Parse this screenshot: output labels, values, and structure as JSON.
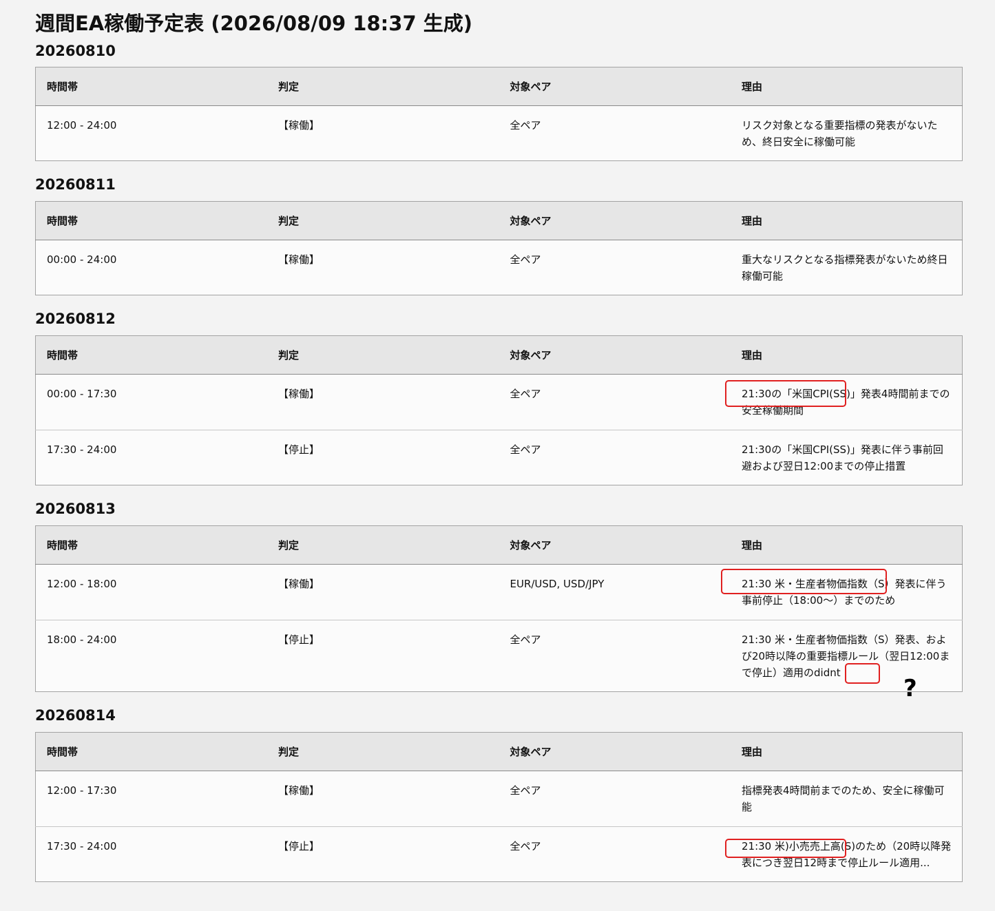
{
  "page_title": "週間EA稼働予定表 (2026/08/09 18:37 生成)",
  "headers": {
    "time": "時間帯",
    "verdict": "判定",
    "pair": "対象ペア",
    "reason": "理由"
  },
  "days": [
    {
      "date": "20260810",
      "rows": [
        {
          "time": "12:00 - 24:00",
          "verdict": "【稼働】",
          "pair": "全ペア",
          "reason": "リスク対象となる重要指標の発表がないため、終日安全に稼働可能"
        }
      ]
    },
    {
      "date": "20260811",
      "rows": [
        {
          "time": "00:00 - 24:00",
          "verdict": "【稼働】",
          "pair": "全ペア",
          "reason": "重大なリスクとなる指標発表がないため終日稼働可能"
        }
      ]
    },
    {
      "date": "20260812",
      "rows": [
        {
          "time": "00:00 - 17:30",
          "verdict": "【稼働】",
          "pair": "全ペア",
          "reason": "21:30の「米国CPI(SS)」発表4時間前までの安全稼働期間"
        },
        {
          "time": "17:30 - 24:00",
          "verdict": "【停止】",
          "pair": "全ペア",
          "reason": "21:30の「米国CPI(SS)」発表に伴う事前回避および翌日12:00までの停止措置"
        }
      ]
    },
    {
      "date": "20260813",
      "rows": [
        {
          "time": "12:00 - 18:00",
          "verdict": "【稼働】",
          "pair": "EUR/USD, USD/JPY",
          "reason": "21:30 米・生産者物価指数（S）発表に伴う事前停止（18:00～）までのため"
        },
        {
          "time": "18:00 - 24:00",
          "verdict": "【停止】",
          "pair": "全ペア",
          "reason": "21:30 米・生産者物価指数（S）発表、および20時以降の重要指標ルール（翌日12:00まで停止）適用のdidnt"
        }
      ]
    },
    {
      "date": "20260814",
      "rows": [
        {
          "time": "12:00 - 17:30",
          "verdict": "【稼働】",
          "pair": "全ペア",
          "reason": "指標発表4時間前までのため、安全に稼働可能"
        },
        {
          "time": "17:30 - 24:00",
          "verdict": "【停止】",
          "pair": "全ペア",
          "reason": "21:30 米)小売売上高(S)のため（20時以降発表につき翌日12時まで停止ルール適用..."
        }
      ]
    }
  ],
  "annotation": {
    "question_mark": "?",
    "highlight_color": "#e02020"
  }
}
